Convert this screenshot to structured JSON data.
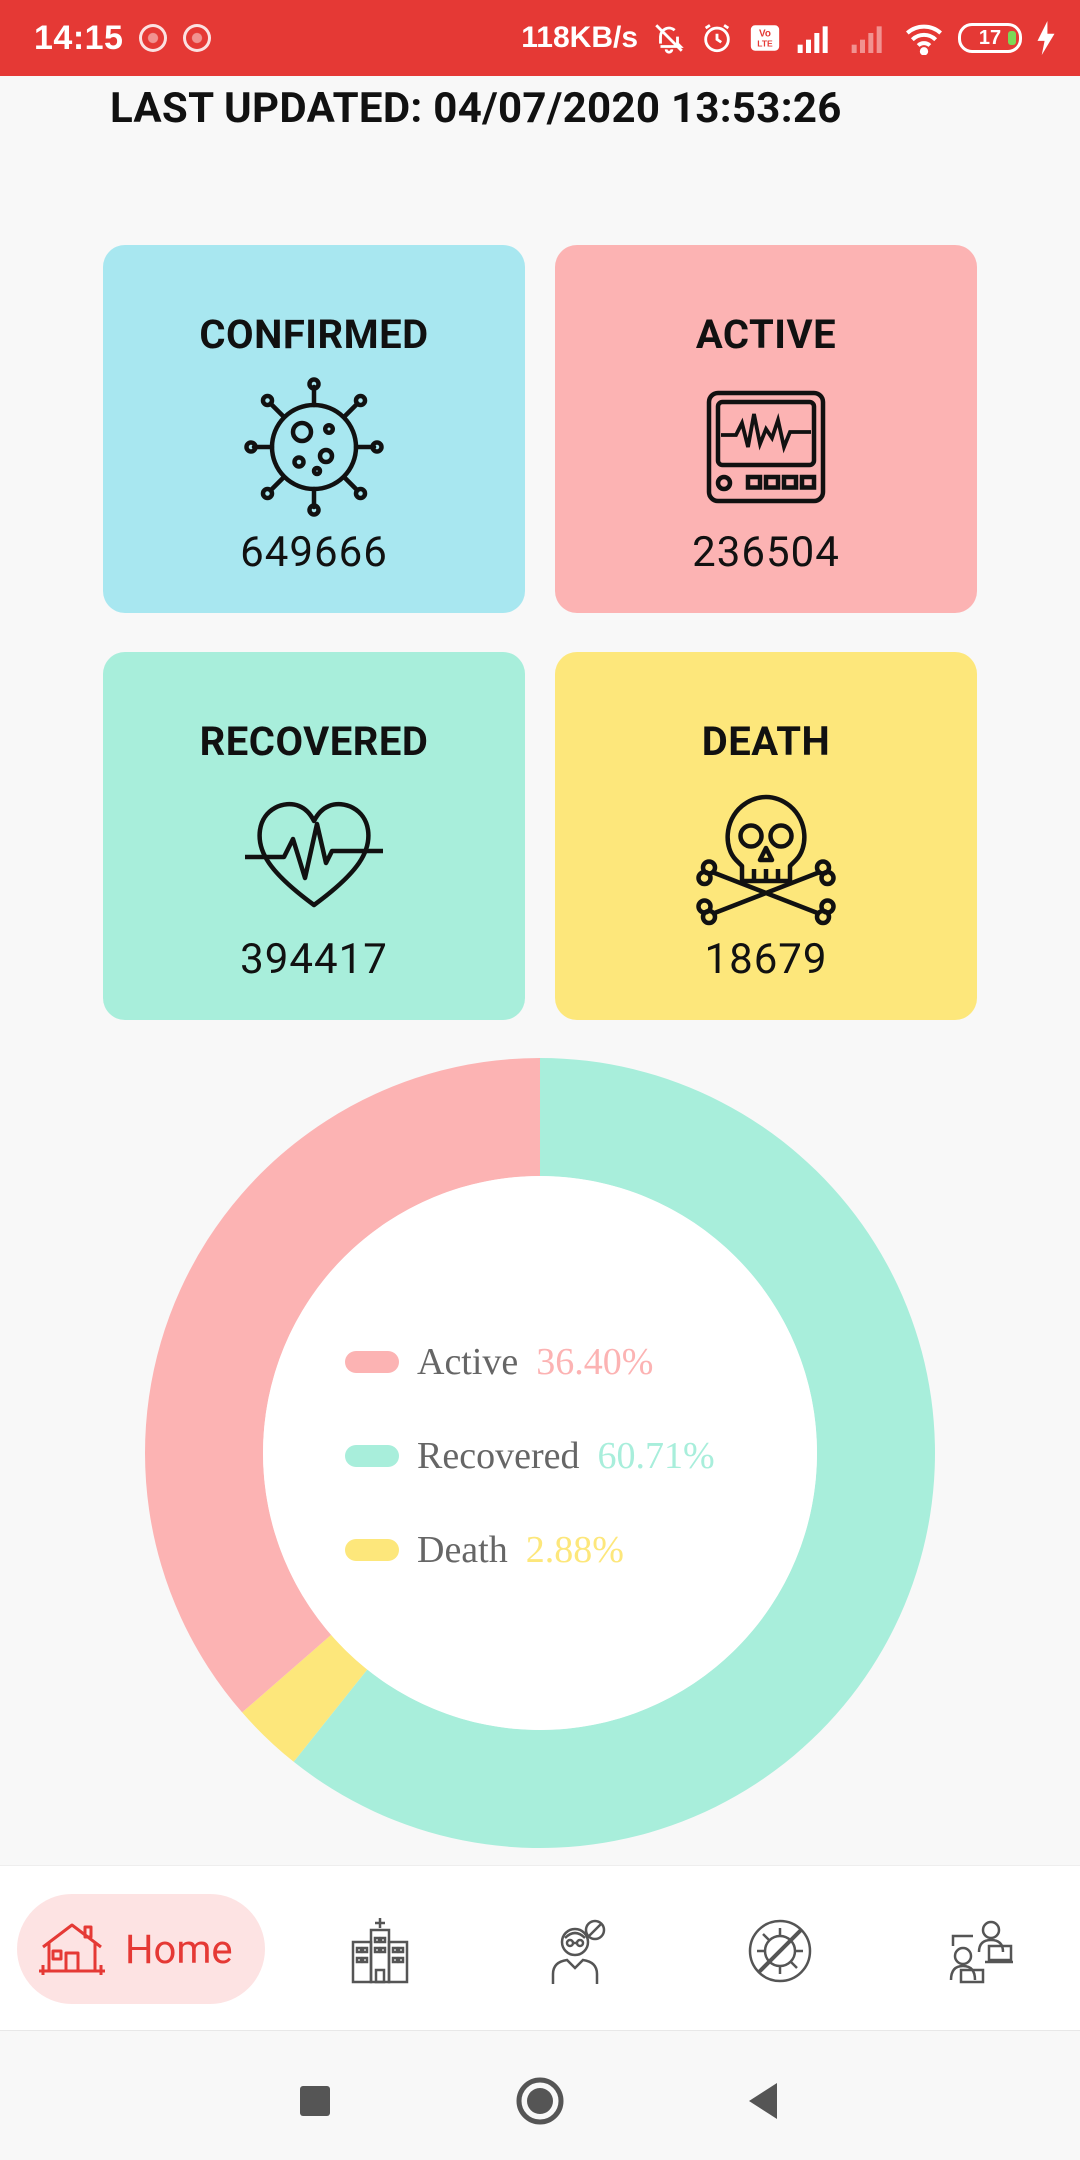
{
  "status_bar": {
    "time": "14:15",
    "speed": "118KB/s",
    "battery": "17"
  },
  "last_updated": "LAST UPDATED: 04/07/2020 13:53:26",
  "cards": {
    "confirmed": {
      "title": "CONFIRMED",
      "value": "649666",
      "color": "#a8e7f0",
      "icon": "virus-icon"
    },
    "active": {
      "title": "ACTIVE",
      "value": "236504",
      "color": "#fcb3b3",
      "icon": "monitor-icon"
    },
    "recovered": {
      "title": "RECOVERED",
      "value": "394417",
      "color": "#a8eedb",
      "icon": "heartbeat-icon"
    },
    "death": {
      "title": "DEATH",
      "value": "18679",
      "color": "#fde77b",
      "icon": "skull-icon"
    }
  },
  "chart_data": {
    "type": "pie",
    "donut": true,
    "categories": [
      "Active",
      "Recovered",
      "Death"
    ],
    "values": [
      36.4,
      60.71,
      2.88
    ],
    "labels": [
      "36.40%",
      "60.71%",
      "2.88%"
    ],
    "colors": [
      "#fcb3b3",
      "#a8eedb",
      "#fde77b"
    ],
    "legend_position": "center"
  },
  "nav": {
    "home_label": "Home",
    "items": [
      "home-icon",
      "hospital-icon",
      "doctor-icon",
      "virus-icon",
      "remote-work-icon"
    ]
  }
}
